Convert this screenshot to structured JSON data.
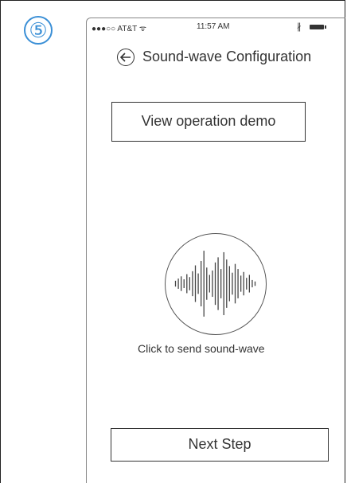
{
  "step": {
    "number": "⑤"
  },
  "status_bar": {
    "carrier": "●●●○○ AT&T ᯤ",
    "time": "11:57 AM",
    "bluetooth": "∦"
  },
  "nav": {
    "back_icon": "arrow-left-circle-icon",
    "title": "Sound-wave Configuration"
  },
  "demo_button": {
    "label": "View operation demo"
  },
  "sound_wave": {
    "icon": "sound-wave-icon",
    "caption": "Click to send sound-wave",
    "bar_levels": [
      0.08,
      0.14,
      0.2,
      0.12,
      0.26,
      0.18,
      0.34,
      0.5,
      0.28,
      0.62,
      0.9,
      0.44,
      0.24,
      0.36,
      0.58,
      0.72,
      0.4,
      0.86,
      0.66,
      0.48,
      0.3,
      0.54,
      0.4,
      0.22,
      0.32,
      0.16,
      0.24,
      0.1,
      0.06
    ]
  },
  "next_button": {
    "label": "Next Step"
  }
}
